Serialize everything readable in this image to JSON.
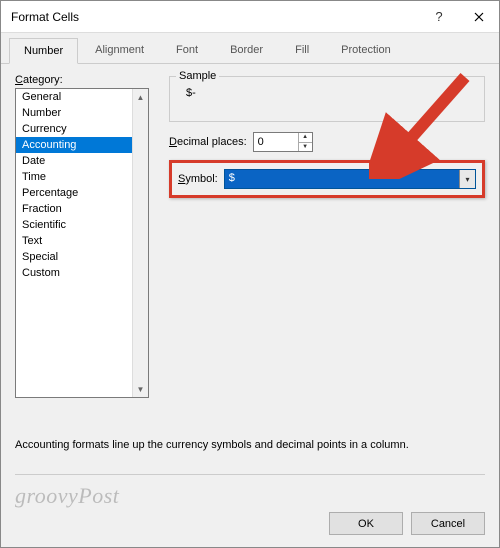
{
  "window": {
    "title": "Format Cells"
  },
  "tabs": [
    "Number",
    "Alignment",
    "Font",
    "Border",
    "Fill",
    "Protection"
  ],
  "active_tab": "Number",
  "category": {
    "label": "Category:",
    "items": [
      "General",
      "Number",
      "Currency",
      "Accounting",
      "Date",
      "Time",
      "Percentage",
      "Fraction",
      "Scientific",
      "Text",
      "Special",
      "Custom"
    ],
    "selected": "Accounting"
  },
  "sample": {
    "label": "Sample",
    "value": "$-"
  },
  "decimal": {
    "label": "Decimal places:",
    "value": "0"
  },
  "symbol": {
    "label": "Symbol:",
    "value": "$"
  },
  "description": "Accounting formats line up the currency symbols and decimal points in a column.",
  "buttons": {
    "ok": "OK",
    "cancel": "Cancel"
  },
  "watermark": "groovyPost",
  "highlight_color": "#d63b2a"
}
